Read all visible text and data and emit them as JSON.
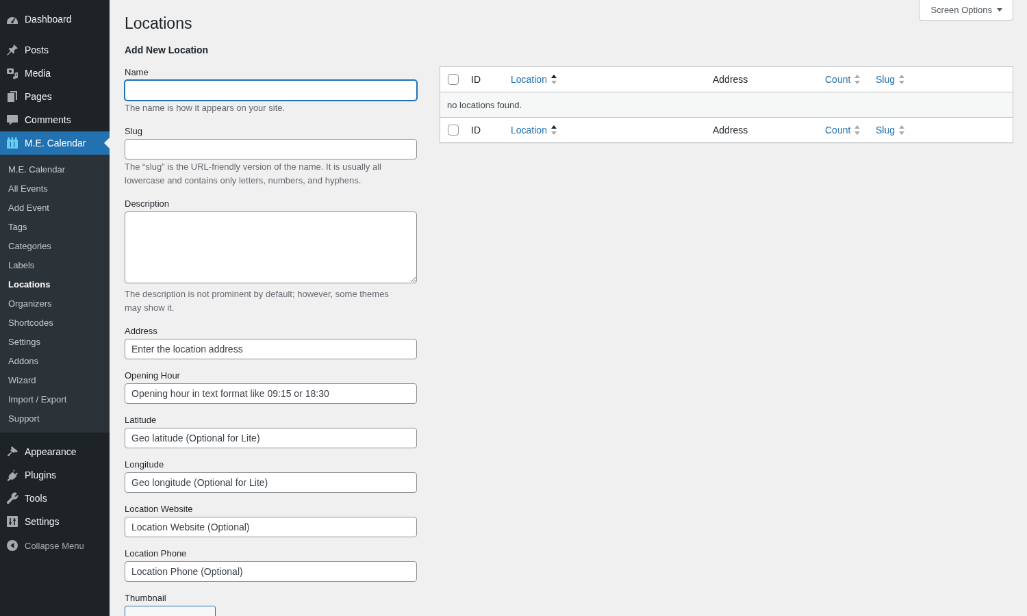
{
  "sidebar": {
    "groups": [
      {
        "items": [
          {
            "label": "Dashboard",
            "selected": false
          }
        ]
      },
      {
        "items": [
          {
            "label": "Posts",
            "selected": false
          },
          {
            "label": "Media",
            "selected": false
          },
          {
            "label": "Pages",
            "selected": false
          },
          {
            "label": "Comments",
            "selected": false
          },
          {
            "label": "M.E. Calendar",
            "selected": true,
            "children": [
              {
                "label": "M.E. Calendar",
                "selected": false
              },
              {
                "label": "All Events",
                "selected": false
              },
              {
                "label": "Add Event",
                "selected": false
              },
              {
                "label": "Tags",
                "selected": false
              },
              {
                "label": "Categories",
                "selected": false
              },
              {
                "label": "Labels",
                "selected": false
              },
              {
                "label": "Locations",
                "selected": true
              },
              {
                "label": "Organizers",
                "selected": false
              },
              {
                "label": "Shortcodes",
                "selected": false
              },
              {
                "label": "Settings",
                "selected": false
              },
              {
                "label": "Addons",
                "selected": false
              },
              {
                "label": "Wizard",
                "selected": false
              },
              {
                "label": "Import / Export",
                "selected": false
              },
              {
                "label": "Support",
                "selected": false
              }
            ]
          }
        ]
      },
      {
        "items": [
          {
            "label": "Appearance",
            "selected": false
          },
          {
            "label": "Plugins",
            "selected": false
          },
          {
            "label": "Tools",
            "selected": false
          },
          {
            "label": "Settings",
            "selected": false
          }
        ]
      }
    ],
    "collapse": {
      "label": "Collapse Menu"
    }
  },
  "page": {
    "title": "Locations",
    "screen_options": {
      "label": "Screen Options"
    }
  },
  "form": {
    "heading": "Add New Location",
    "fields": [
      {
        "kind": "text",
        "label": "Name",
        "focused": true,
        "description": "The name is how it appears on your site."
      },
      {
        "kind": "text",
        "label": "Slug",
        "focused": false,
        "description": "The “slug” is the URL-friendly version of the name. It is usually all lowercase and contains only letters, numbers, and hyphens."
      },
      {
        "kind": "textarea",
        "label": "Description",
        "focused": false,
        "description": "The description is not prominent by default; however, some themes may show it."
      },
      {
        "kind": "text",
        "label": "Address",
        "focused": false,
        "placeholder": "Enter the location address"
      },
      {
        "kind": "text",
        "label": "Opening Hour",
        "focused": false,
        "placeholder": "Opening hour in text format like 09:15 or 18:30"
      },
      {
        "kind": "text",
        "label": "Latitude",
        "focused": false,
        "placeholder": "Geo latitude (Optional for Lite)"
      },
      {
        "kind": "text",
        "label": "Longitude",
        "focused": false,
        "placeholder": "Geo longitude (Optional for Lite)"
      },
      {
        "kind": "text",
        "label": "Location Website",
        "focused": false,
        "placeholder": "Location Website (Optional)"
      },
      {
        "kind": "text",
        "label": "Location Phone",
        "focused": false,
        "placeholder": "Location Phone (Optional)"
      },
      {
        "kind": "upload",
        "label": "Thumbnail"
      }
    ]
  },
  "table": {
    "header": {
      "select_all": {
        "checked": false
      },
      "columns": [
        {
          "label": "ID",
          "sortable": false
        },
        {
          "label": "Location",
          "sortable": true,
          "sorted": true
        },
        {
          "label": "Address",
          "sortable": false
        },
        {
          "label": "Count",
          "sortable": true,
          "sorted": false
        },
        {
          "label": "Slug",
          "sortable": true,
          "sorted": false
        }
      ]
    },
    "empty_message": "no locations found.",
    "footer": {
      "select_all": {
        "checked": false
      },
      "columns": [
        {
          "label": "ID",
          "sortable": false
        },
        {
          "label": "Location",
          "sortable": true,
          "sorted": true
        },
        {
          "label": "Address",
          "sortable": false
        },
        {
          "label": "Count",
          "sortable": true,
          "sorted": false
        },
        {
          "label": "Slug",
          "sortable": true,
          "sorted": false
        }
      ]
    }
  }
}
